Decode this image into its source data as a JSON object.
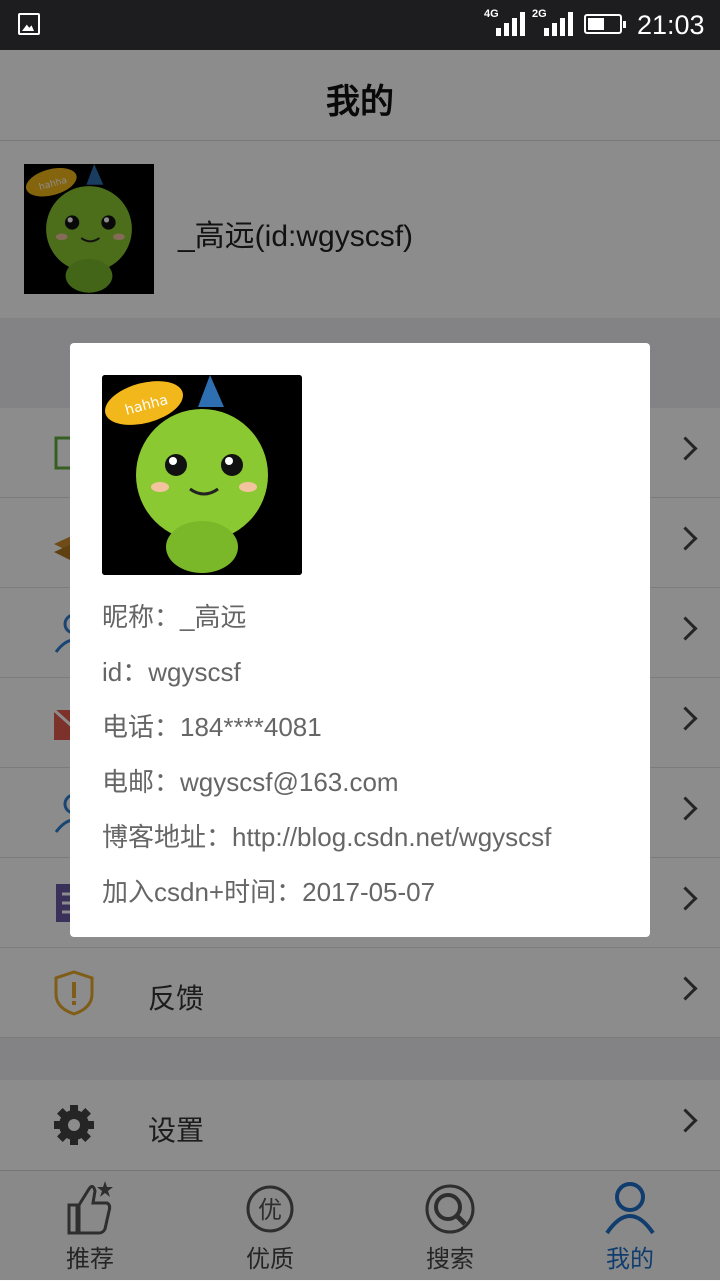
{
  "status_bar": {
    "net1": "4G",
    "net2": "2G",
    "time": "21:03"
  },
  "header": {
    "title": "我的"
  },
  "profile": {
    "name": "_高远(id:wgyscsf)"
  },
  "menu": {
    "items": [
      {
        "icon": "picture-icon",
        "label": ""
      },
      {
        "icon": "stack-icon",
        "label": ""
      },
      {
        "icon": "person-icon",
        "label": ""
      },
      {
        "icon": "mail-icon",
        "label": ""
      },
      {
        "icon": "person-icon",
        "label": ""
      },
      {
        "icon": "document-icon",
        "label": ""
      },
      {
        "icon": "shield-icon",
        "label": "反馈"
      }
    ],
    "settings": {
      "icon": "gear-icon",
      "label": "设置"
    }
  },
  "dialog": {
    "nickname": "昵称：_高远",
    "id": "id：wgyscsf",
    "phone": "电话：184****4081",
    "email": "电邮：wgyscsf@163.com",
    "blog": "博客地址：http://blog.csdn.net/wgyscsf",
    "joined": "加入csdn+时间：2017-05-07"
  },
  "tabbar": {
    "tabs": [
      {
        "label": "推荐",
        "icon": "thumbs-up-icon"
      },
      {
        "label": "优质",
        "icon": "quality-icon"
      },
      {
        "label": "搜索",
        "icon": "search-icon"
      },
      {
        "label": "我的",
        "icon": "user-icon"
      }
    ],
    "active_color": "#1e6fc8"
  },
  "colors": {
    "overlay": "rgba(0,0,0,0.45)",
    "accent": "#1e6fc8"
  }
}
